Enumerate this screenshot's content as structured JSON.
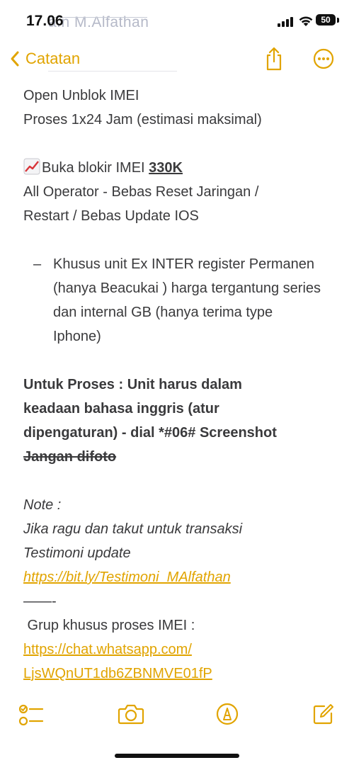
{
  "status_bar": {
    "time": "17.06",
    "overlay_text": "a.n M.Alfathan",
    "battery": "50"
  },
  "nav": {
    "back_label": "Catatan",
    "icons": [
      "chevron-left-icon",
      "share-icon",
      "more-icon"
    ]
  },
  "note": {
    "line1": "Open Unblok IMEI",
    "line2": "Proses 1x24 Jam (estimasi maksimal)",
    "price_emoji": "📈",
    "price_prefix": "Buka blokir IMEI ",
    "price_value": "330K",
    "line4": "All Operator - Bebas Reset Jaringan /",
    "line5": "Restart / Bebas Update IOS",
    "bullet_dash": "–",
    "bullet_text": "Khusus unit Ex INTER register Permanen (hanya Beacukai ) harga tergantung series dan internal GB (hanya terima type Iphone)",
    "bold1": "Untuk Proses : Unit harus dalam",
    "bold2": "keadaan bahasa inggris (atur",
    "bold3": "dipengaturan) - dial *#06# Screenshot",
    "strike": "Jangan difoto",
    "note_label": "Note :",
    "italic1": "Jika ragu dan takut untuk transaksi",
    "italic2": "Testimoni update",
    "testimoni_link": "https://bit.ly/Testimoni_MAlfathan",
    "separator": "——-",
    "group_label": " Grup khusus proses IMEI :",
    "wa_link1": "https://chat.whatsapp.com/",
    "wa_link2": "LjsWQnUT1db6ZBNMVE01fP"
  },
  "toolbar": {
    "icons": [
      "checklist-icon",
      "camera-icon",
      "markup-pen-icon",
      "compose-icon"
    ]
  },
  "colors": {
    "accent": "#E1A400",
    "text": "#3A3A3C",
    "background": "#FFFFFF"
  }
}
